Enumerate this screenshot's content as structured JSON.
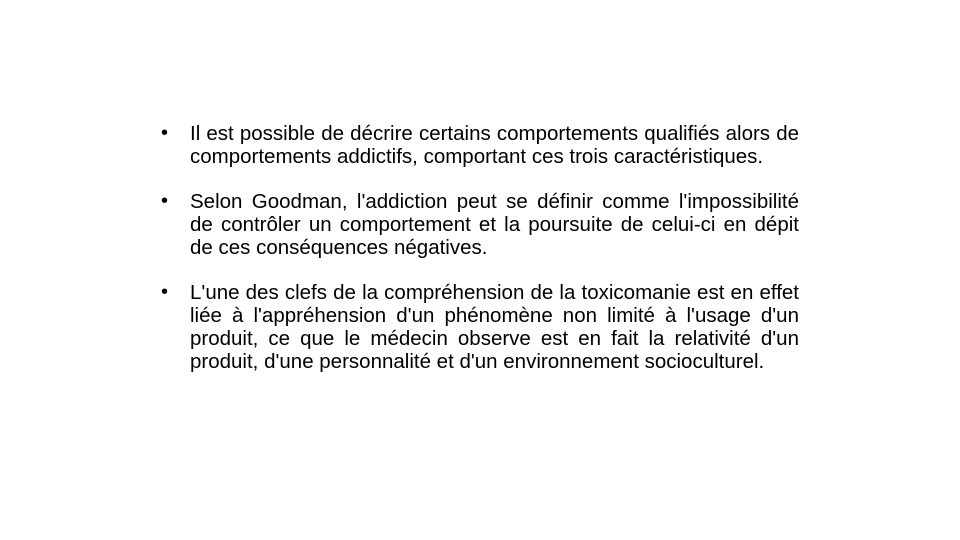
{
  "slide": {
    "bullet_glyph": "•",
    "items": [
      {
        "text": "Il est possible de décrire certains comportements qualifiés alors de comportements addictifs, comportant ces trois caractéristiques."
      },
      {
        "text": "Selon Goodman, l'addiction peut se définir comme l'impossibilité de contrôler un comportement et la poursuite de celui-ci en dépit de ces conséquences négatives."
      },
      {
        "text": "L'une des clefs de la compréhension de la toxicomanie est en effet liée à l'appréhension d'un phénomène non limité à l'usage d'un produit, ce que le médecin observe est en fait la relativité d'un produit, d'une personnalité et d'un environnement socioculturel."
      }
    ]
  }
}
